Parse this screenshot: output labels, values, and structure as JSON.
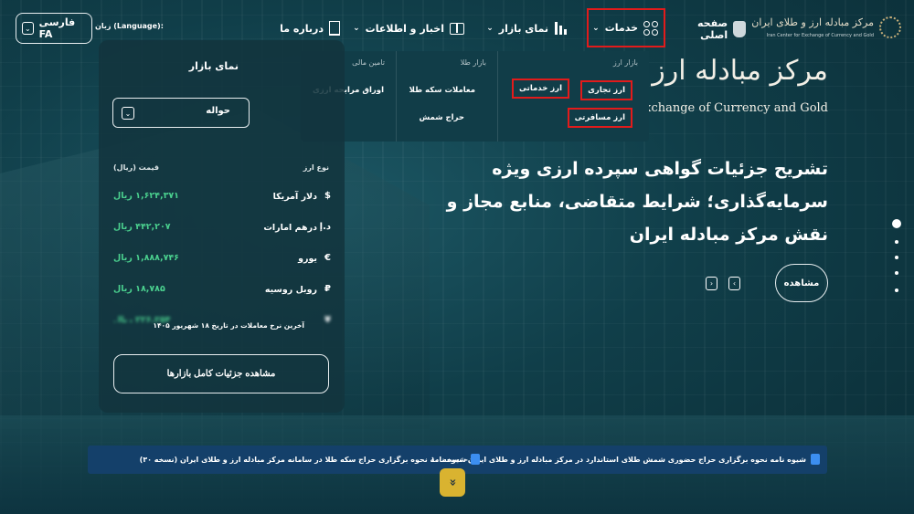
{
  "logo": {
    "name_fa": "مرکز مبادله ارز و طلای ایران",
    "name_en": "Iran Center for Exchange of Currency and Gold"
  },
  "nav": {
    "home": "صفحه اصلی",
    "services": "خدمات",
    "market_view": "نمای بازار",
    "news": "اخبار و اطلاعات",
    "about": "درباره ما"
  },
  "language": {
    "label": "زبان (Language):",
    "value": "فارسی FA"
  },
  "services_menu": {
    "forex": {
      "heading": "بازار ارز",
      "items": [
        "ارز تجاری",
        "ارز خدماتی",
        "ارز مسافرتی"
      ]
    },
    "gold": {
      "heading": "بازار طلا",
      "items": [
        "معاملات سکه طلا",
        "حراج شمش"
      ]
    },
    "finance": {
      "heading": "تامین مالی",
      "items": [
        "اوراق مرابحه ارزی"
      ]
    }
  },
  "market_panel": {
    "title": "نمای بازار",
    "selected": "حواله",
    "col_type": "نوع ارز",
    "col_price": "قیمت (ریال)",
    "rows": [
      {
        "symbol": "$",
        "name": "دلار آمریکا",
        "price": "۱,۶۲۴,۳۷۱ ریال"
      },
      {
        "symbol": "د.إ",
        "name": "درهم امارات",
        "price": "۴۴۲,۲۰۷ ریال"
      },
      {
        "symbol": "€",
        "name": "یورو",
        "price": "۱,۸۸۸,۷۴۶ ریال"
      },
      {
        "symbol": "₽",
        "name": "روبل روسیه",
        "price": "۱۸,۷۸۵ ریال"
      }
    ],
    "partial_row": {
      "symbol": "¥",
      "price": "۲۲۶,۲۵۴ ریال"
    },
    "footnote": "آخرین نرخ معاملات در تاریخ ۱۸ شهریور ۱۴۰۵",
    "button": "مشاهده جزئیات کامل بازارها"
  },
  "hero": {
    "brand_fa": "مرکز مبادله ارز و طلا",
    "brand_en": "or Exchange of Currency and Gold",
    "title": "تشریح جزئیات گواهی سپرده ارزی ویژه سرمایه‌گذاری؛ شرایط متقاضی، منابع مجاز و نقش مرکز مبادله ایران",
    "button": "مشاهده",
    "prev": "‹",
    "next": "›"
  },
  "ticker": {
    "items": [
      "شیوه نامه نحوه برگزاری حراج حضوری شمش طلای استاندارد در مرکز مبادله ارز و طلای ایران- نسخه ۱۰",
      "شیوه نامه نحوه برگزاری حراج سکه طلا در سامانه مرکز مبادله ارز و طلای ایران (نسخه ۳۰)"
    ]
  },
  "scroll_label": "»"
}
